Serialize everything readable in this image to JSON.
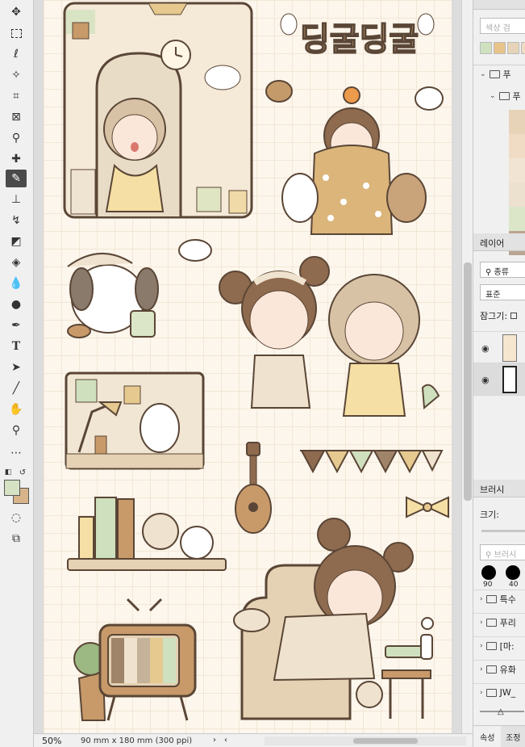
{
  "toolbar": {
    "tools": [
      "move-tool",
      "marquee-tool",
      "lasso-tool",
      "magic-wand-tool",
      "crop-tool",
      "frame-tool",
      "eyedropper-tool",
      "healing-tool",
      "brush-tool",
      "stamp-tool",
      "history-brush-tool",
      "eraser-tool",
      "paint-bucket-tool",
      "blur-tool",
      "dodge-tool",
      "pen-tool",
      "type-tool",
      "path-select-tool",
      "line-tool",
      "hand-tool",
      "zoom-tool",
      "more-tools"
    ],
    "active_tool": "brush-tool",
    "foreground_color": "#d6e2c4",
    "background_color": "#d8b48a"
  },
  "canvas": {
    "title_text": "딩굴딩굴"
  },
  "status": {
    "zoom": "50%",
    "doc_info": "90 mm x 180 mm (300 ppi)"
  },
  "swatches_panel": {
    "search_placeholder": "색상 검",
    "groups": [
      "푸",
      "푸"
    ],
    "colors": [
      "#cfe0bf",
      "#e9c48a",
      "#e7d4b8",
      "#f0dcc4",
      "#f2e4d2",
      "#ece0cf",
      "#dbe6c9",
      "#b9a592"
    ]
  },
  "layers_panel": {
    "tab": "레이어",
    "filter": "종류",
    "blend_mode": "표준",
    "lock_label": "잠그기:"
  },
  "brush_panel": {
    "tab": "브러시",
    "size_label": "크기:",
    "search_placeholder": "브러시",
    "sizes": [
      "90",
      "40"
    ],
    "folders": [
      "특수",
      "푸리",
      "[마:",
      "유화",
      "JW_"
    ]
  },
  "bottom_tabs": [
    "속성",
    "조정"
  ]
}
